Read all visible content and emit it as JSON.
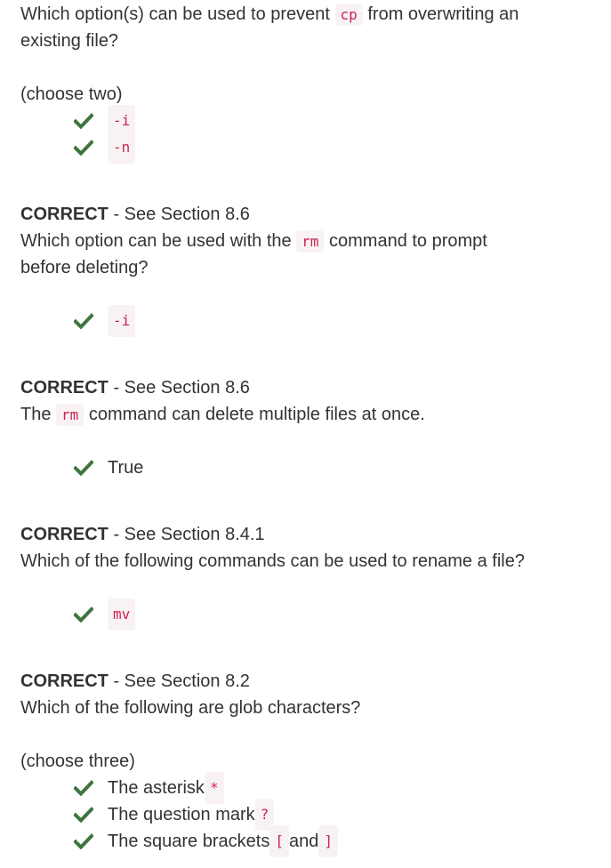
{
  "q1": {
    "text_a": "Which option(s) can be used to prevent ",
    "code": "cp",
    "text_b": " from overwriting an",
    "text_c": "existing file?",
    "hint": "(choose two)",
    "answers": [
      "-i",
      "-n"
    ]
  },
  "q2": {
    "result_label": "CORRECT",
    "result_ref": " - See Section 8.6",
    "text_a": "Which option can be used with the ",
    "code": "rm",
    "text_b": " command to prompt",
    "text_c": "before deleting?",
    "answers": [
      "-i"
    ]
  },
  "q3": {
    "result_label": "CORRECT",
    "result_ref": " - See Section 8.6",
    "text_a": "The ",
    "code": "rm",
    "text_b": " command can delete multiple files at once.",
    "answers": [
      "True"
    ]
  },
  "q4": {
    "result_label": "CORRECT",
    "result_ref": " - See Section 8.4.1",
    "text": "Which of the following commands can be used to rename a file?",
    "answers": [
      "mv"
    ]
  },
  "q5": {
    "result_label": "CORRECT",
    "result_ref": " - See Section 8.2",
    "text": "Which of the following are glob characters?",
    "hint": "(choose three)",
    "answers": [
      {
        "label": "The asterisk ",
        "code": "*"
      },
      {
        "label": "The question mark ",
        "code": "?"
      },
      {
        "label": "The square brackets ",
        "code1": "[",
        "mid": " and ",
        "code2": "]"
      }
    ]
  },
  "colors": {
    "check": "#3c763d",
    "code_text": "#c7254e",
    "code_bg": "#f9f2f4"
  },
  "icons": {
    "check": "check-icon"
  }
}
